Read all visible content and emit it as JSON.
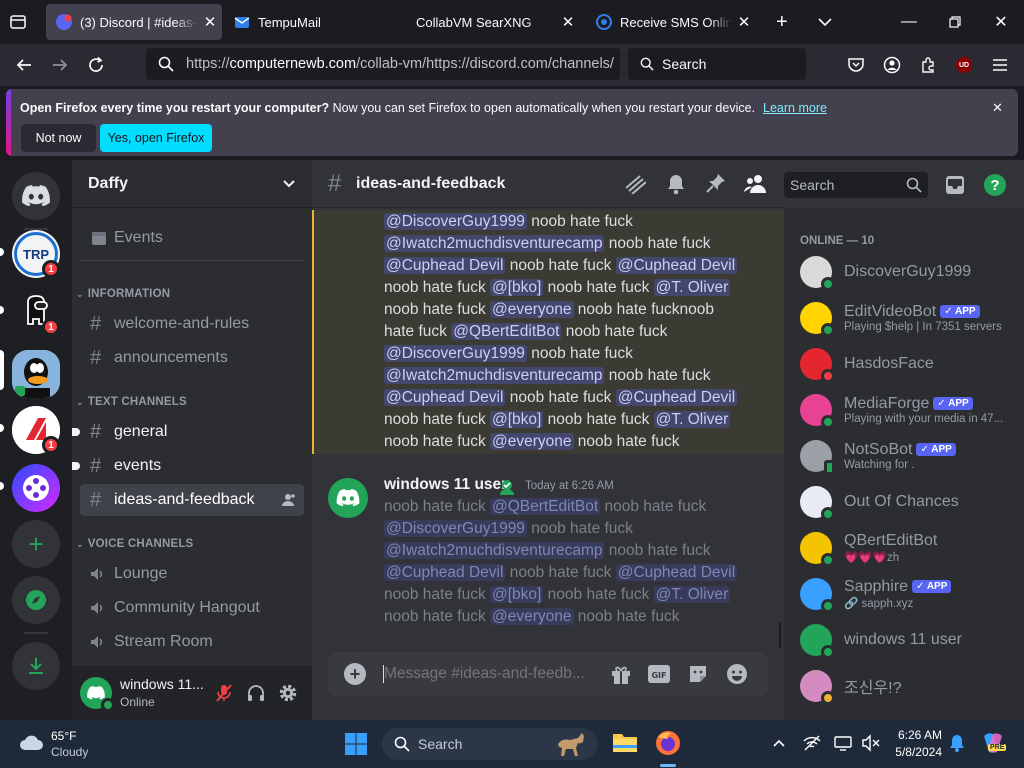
{
  "browser": {
    "tabs": [
      {
        "title": "(3) Discord | #ideas-and-feedback",
        "active": true
      },
      {
        "title": "TempuMail",
        "active": false
      },
      {
        "title": "CollabVM SearXNG",
        "active": false
      },
      {
        "title": "Receive SMS Online - SMS",
        "active": false
      }
    ],
    "url_prefix": "https://",
    "url_host": "computernewb.com",
    "url_path": "/collab-vm/https://discord.com/channels/",
    "search_placeholder": "Search",
    "profile_badge": "UD"
  },
  "notification": {
    "bold": "Open Firefox every time you restart your computer?",
    "text": " Now you can set Firefox to open automatically when you restart your device.",
    "link": "Learn more",
    "not_now": "Not now",
    "yes": "Yes, open Firefox"
  },
  "guilds": [
    {
      "name": "TRP",
      "badge": "1"
    },
    {
      "name": "",
      "badge": "1"
    },
    {
      "name": "",
      "badge": ""
    },
    {
      "name": "",
      "badge": "1"
    },
    {
      "name": "",
      "badge": ""
    }
  ],
  "server": {
    "name": "Daffy",
    "events": "Events",
    "categories": {
      "information": "INFORMATION",
      "text": "TEXT CHANNELS",
      "voice": "VOICE CHANNELS"
    },
    "info_channels": [
      "welcome-and-rules",
      "announcements"
    ],
    "text_channels": [
      "general",
      "events",
      "ideas-and-feedback"
    ],
    "voice_channels": [
      "Lounge",
      "Community Hangout",
      "Stream Room"
    ]
  },
  "user": {
    "name": "windows 11...",
    "status": "Online"
  },
  "chat": {
    "channel": "ideas-and-feedback",
    "search_placeholder": "Search",
    "message_placeholder": "Message #ideas-and-feedb...",
    "msg1_lines": [
      [
        {
          "m": "@DiscoverGuy1999"
        },
        {
          "t": " noob hate fuck"
        }
      ],
      [
        {
          "m": "@Iwatch2muchdisventurecamp"
        },
        {
          "t": " noob hate fuck"
        }
      ],
      [
        {
          "m": "@Cuphead Devil"
        },
        {
          "t": " noob hate fuck "
        },
        {
          "m": "@Cuphead Devil"
        }
      ],
      [
        {
          "t": "noob hate fuck "
        },
        {
          "m": "@[bko]"
        },
        {
          "t": " noob hate fuck "
        },
        {
          "m": "@T. Oliver"
        }
      ],
      [
        {
          "t": "noob hate fuck "
        },
        {
          "m": "@everyone"
        },
        {
          "t": " noob hate fucknoob"
        }
      ],
      [
        {
          "t": "hate fuck "
        },
        {
          "m": "@QBertEditBot"
        },
        {
          "t": " noob hate fuck"
        }
      ],
      [
        {
          "m": "@DiscoverGuy1999"
        },
        {
          "t": " noob hate fuck"
        }
      ],
      [
        {
          "m": "@Iwatch2muchdisventurecamp"
        },
        {
          "t": " noob hate fuck"
        }
      ],
      [
        {
          "m": "@Cuphead Devil"
        },
        {
          "t": " noob hate fuck "
        },
        {
          "m": "@Cuphead Devil"
        }
      ],
      [
        {
          "t": "noob hate fuck "
        },
        {
          "m": "@[bko]"
        },
        {
          "t": " noob hate fuck "
        },
        {
          "m": "@T. Oliver"
        }
      ],
      [
        {
          "t": "noob hate fuck "
        },
        {
          "m": "@everyone"
        },
        {
          "t": " noob hate fuck"
        }
      ]
    ],
    "msg2_author": "windows 11 user",
    "msg2_time": "Today at 6:26 AM",
    "msg2_lines": [
      [
        {
          "t": "noob hate fuck "
        },
        {
          "m": "@QBertEditBot"
        },
        {
          "t": " noob hate fuck"
        }
      ],
      [
        {
          "m": "@DiscoverGuy1999"
        },
        {
          "t": " noob hate fuck"
        }
      ],
      [
        {
          "m": "@Iwatch2muchdisventurecamp"
        },
        {
          "t": " noob hate fuck"
        }
      ],
      [
        {
          "m": "@Cuphead Devil"
        },
        {
          "t": " noob hate fuck "
        },
        {
          "m": "@Cuphead Devil"
        }
      ],
      [
        {
          "t": "noob hate fuck "
        },
        {
          "m": "@[bko]"
        },
        {
          "t": " noob hate fuck "
        },
        {
          "m": "@T. Oliver"
        }
      ],
      [
        {
          "t": "noob hate fuck "
        },
        {
          "m": "@everyone"
        },
        {
          "t": " noob hate fuck"
        }
      ]
    ]
  },
  "members": {
    "header": "ONLINE — 10",
    "list": [
      {
        "name": "DiscoverGuy1999",
        "sub": "",
        "app": false,
        "status": "online"
      },
      {
        "name": "EditVideoBot",
        "sub": "Playing $help | In 7351 servers",
        "app": true,
        "status": "online"
      },
      {
        "name": "HasdosFace",
        "sub": "",
        "app": false,
        "status": "dnd"
      },
      {
        "name": "MediaForge",
        "sub": "Playing with your media in 47...",
        "app": true,
        "status": "online"
      },
      {
        "name": "NotSoBot",
        "sub": "Watching for .",
        "app": true,
        "status": "mobile"
      },
      {
        "name": "Out Of Chances",
        "sub": "",
        "app": false,
        "status": "online"
      },
      {
        "name": "QBertEditBot",
        "sub": "💗💗💗zh",
        "app": false,
        "status": "online"
      },
      {
        "name": "Sapphire",
        "sub": "🔗 sapph.xyz",
        "app": true,
        "status": "online"
      },
      {
        "name": "windows 11 user",
        "sub": "",
        "app": false,
        "status": "online"
      },
      {
        "name": "조신우!?",
        "sub": "",
        "app": false,
        "status": "idle"
      }
    ],
    "app_label": "APP"
  },
  "taskbar": {
    "weather_temp": "65°F",
    "weather_desc": "Cloudy",
    "search": "Search",
    "time": "6:26 AM",
    "date": "5/8/2024",
    "copilot_badge": "PRE"
  },
  "colors": {
    "discord_blurple": "#5865f2",
    "online": "#23a559",
    "dnd": "#f23f43",
    "idle": "#f0b232",
    "firefox_accent": "#00ddff"
  }
}
